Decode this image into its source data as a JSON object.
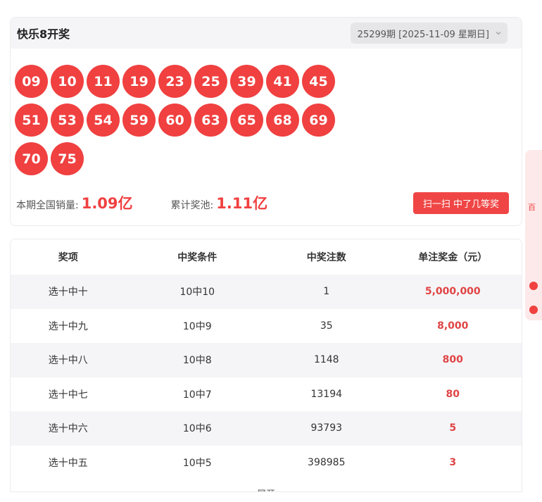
{
  "header": {
    "title": "快乐8开奖",
    "period_select": "25299期 [2025-11-09 星期日]"
  },
  "numbers": {
    "row1": [
      "09",
      "10",
      "11",
      "19",
      "23",
      "25",
      "39",
      "41",
      "45"
    ],
    "row2": [
      "51",
      "53",
      "54",
      "59",
      "60",
      "63",
      "65",
      "68",
      "69"
    ],
    "row3": [
      "70",
      "75"
    ]
  },
  "sales": {
    "sales_label": "本期全国销量:",
    "sales_value": "1.09亿",
    "pool_label": "累计奖池:",
    "pool_value": "1.11亿",
    "scan_button": "扫一扫 中了几等奖"
  },
  "table": {
    "headers": [
      "奖项",
      "中奖条件",
      "中奖注数",
      "单注奖金（元）"
    ],
    "rows": [
      {
        "name": "选十中十",
        "cond": "10中10",
        "count": "1",
        "prize": "5,000,000"
      },
      {
        "name": "选十中九",
        "cond": "10中9",
        "count": "35",
        "prize": "8,000"
      },
      {
        "name": "选十中八",
        "cond": "10中8",
        "count": "1148",
        "prize": "800"
      },
      {
        "name": "选十中七",
        "cond": "10中7",
        "count": "13194",
        "prize": "80"
      },
      {
        "name": "选十中六",
        "cond": "10中6",
        "count": "93793",
        "prize": "5"
      },
      {
        "name": "选十中五",
        "cond": "10中5",
        "count": "398985",
        "prize": "3"
      }
    ],
    "expand_label": "展开"
  },
  "colors": {
    "accent": "#f04040",
    "header_bg": "#f5f5f7",
    "row_alt_bg": "#f5f5f8"
  },
  "icons": {
    "period_select": "chevron-down-icon"
  },
  "side_float": {
    "text": "百"
  }
}
